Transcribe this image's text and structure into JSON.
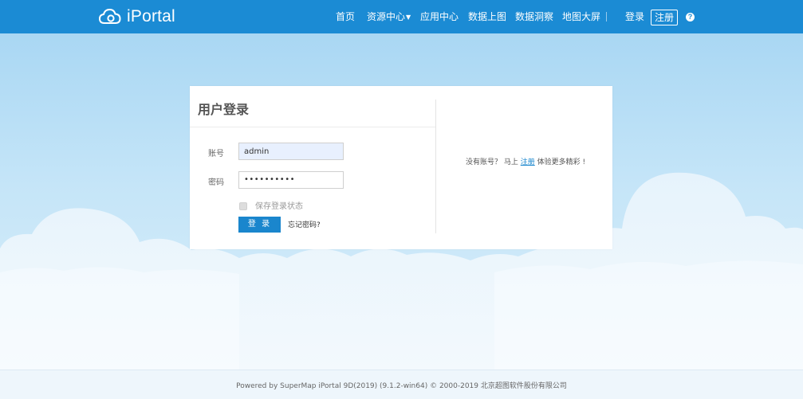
{
  "header": {
    "logo_text": "iPortal",
    "logo_icon": "cloud-logo-icon",
    "nav": {
      "home": "首页",
      "resources": "资源中心",
      "apps": "应用中心",
      "upload": "数据上图",
      "insights": "数据洞察",
      "bigscreen": "地图大屏"
    },
    "login": "登录",
    "register": "注册",
    "help_icon": "?"
  },
  "login_card": {
    "title": "用户登录",
    "account_label": "账号",
    "account_value": "admin",
    "password_label": "密码",
    "password_value": "••••••••••",
    "remember_label": "保存登录状态",
    "login_button": "登 录",
    "forgot_link": "忘记密码?",
    "no_account_text": "没有账号？ 马上",
    "register_link": "注册",
    "experience_text": "体验更多精彩 !"
  },
  "footer": {
    "text": "Powered by SuperMap iPortal 9D(2019) (9.1.2-win64) © 2000-2019 北京超图软件股份有限公司"
  },
  "colors": {
    "header_bg": "#1b8bd4",
    "button_bg": "#1a86cd",
    "sky_top": "#a9d7f3"
  }
}
